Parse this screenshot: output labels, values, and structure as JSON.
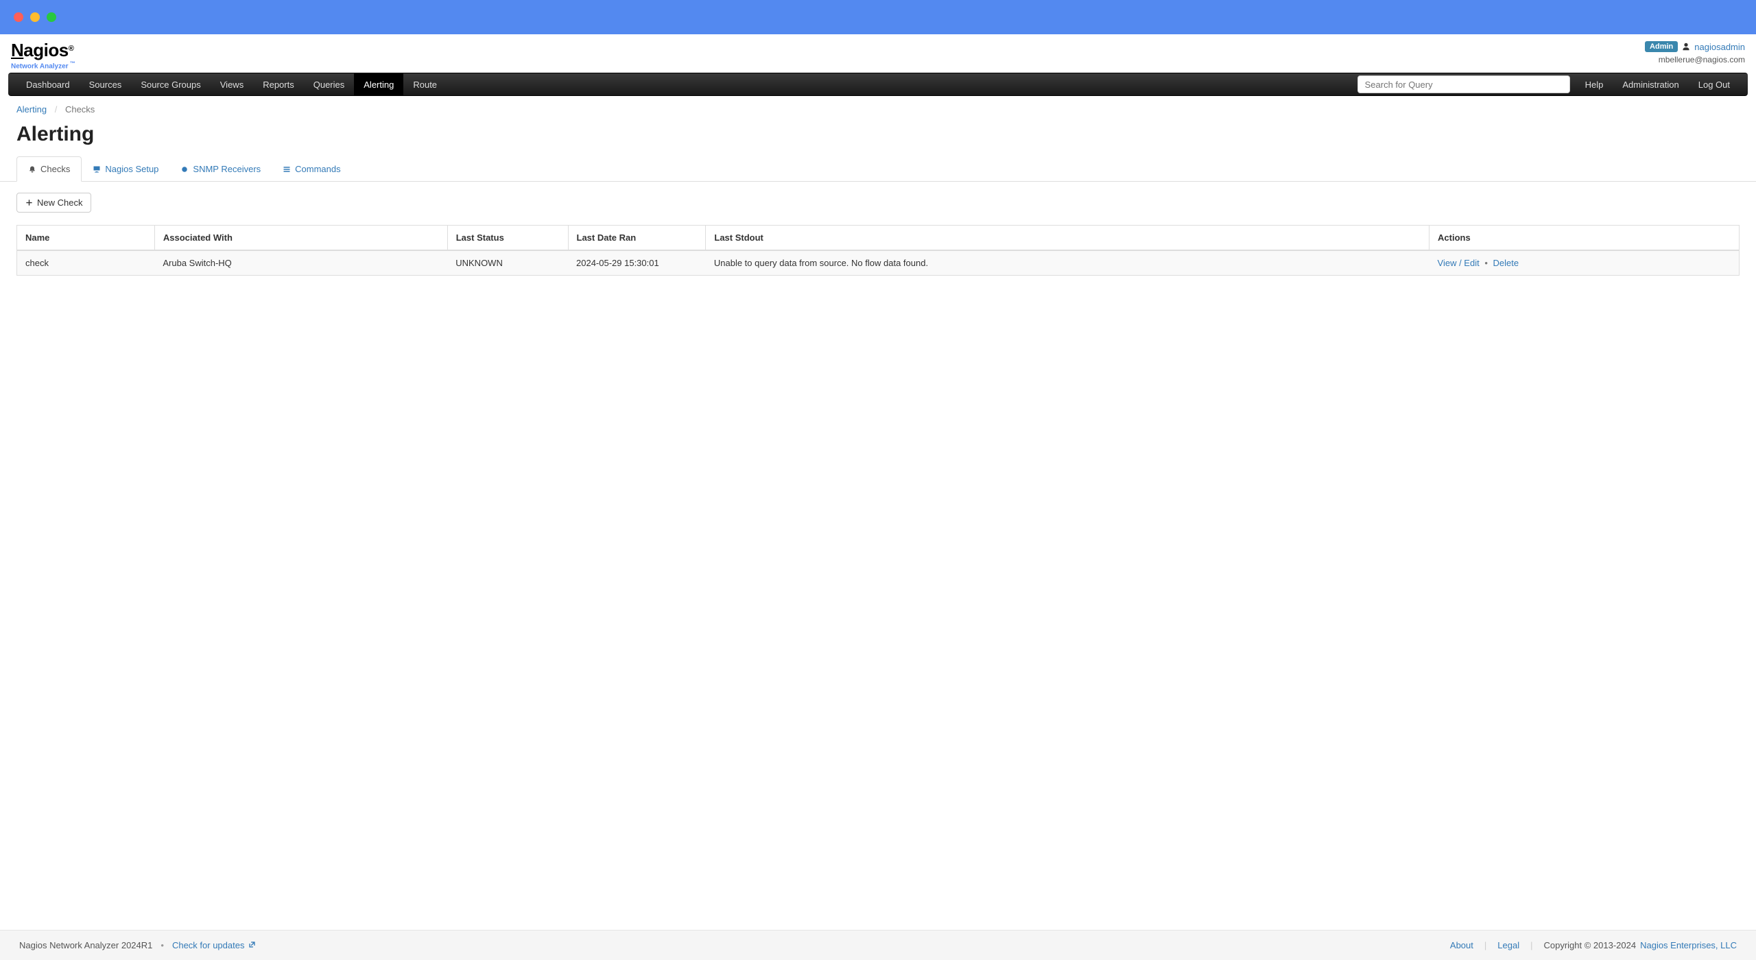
{
  "header": {
    "logo_main": "Nagios",
    "logo_sub": "Network Analyzer",
    "admin_badge": "Admin",
    "username": "nagiosadmin",
    "email": "mbellerue@nagios.com"
  },
  "nav": {
    "left": [
      {
        "label": "Dashboard"
      },
      {
        "label": "Sources"
      },
      {
        "label": "Source Groups"
      },
      {
        "label": "Views"
      },
      {
        "label": "Reports"
      },
      {
        "label": "Queries"
      },
      {
        "label": "Alerting",
        "active": true
      },
      {
        "label": "Route"
      }
    ],
    "search_placeholder": "Search for Query",
    "right": [
      {
        "label": "Help"
      },
      {
        "label": "Administration"
      },
      {
        "label": "Log Out"
      }
    ]
  },
  "breadcrumb": {
    "items": [
      {
        "label": "Alerting",
        "link": true
      },
      {
        "label": "Checks",
        "link": false
      }
    ]
  },
  "page": {
    "title": "Alerting"
  },
  "tabs": [
    {
      "label": "Checks",
      "active": true,
      "icon": "bell"
    },
    {
      "label": "Nagios Setup",
      "active": false,
      "icon": "desktop"
    },
    {
      "label": "SNMP Receivers",
      "active": false,
      "icon": "circle"
    },
    {
      "label": "Commands",
      "active": false,
      "icon": "list"
    }
  ],
  "buttons": {
    "new_check": "New Check"
  },
  "table": {
    "headers": [
      "Name",
      "Associated With",
      "Last Status",
      "Last Date Ran",
      "Last Stdout",
      "Actions"
    ],
    "rows": [
      {
        "name": "check",
        "associated_with": "Aruba Switch-HQ",
        "last_status": "UNKNOWN",
        "last_date_ran": "2024-05-29 15:30:01",
        "last_stdout": "Unable to query data from source. No flow data found.",
        "actions": {
          "view_edit": "View / Edit",
          "delete": "Delete"
        }
      }
    ]
  },
  "footer": {
    "product": "Nagios Network Analyzer 2024R1",
    "check_updates": "Check for updates",
    "about": "About",
    "legal": "Legal",
    "copyright": "Copyright © 2013-2024",
    "company": "Nagios Enterprises, LLC"
  }
}
